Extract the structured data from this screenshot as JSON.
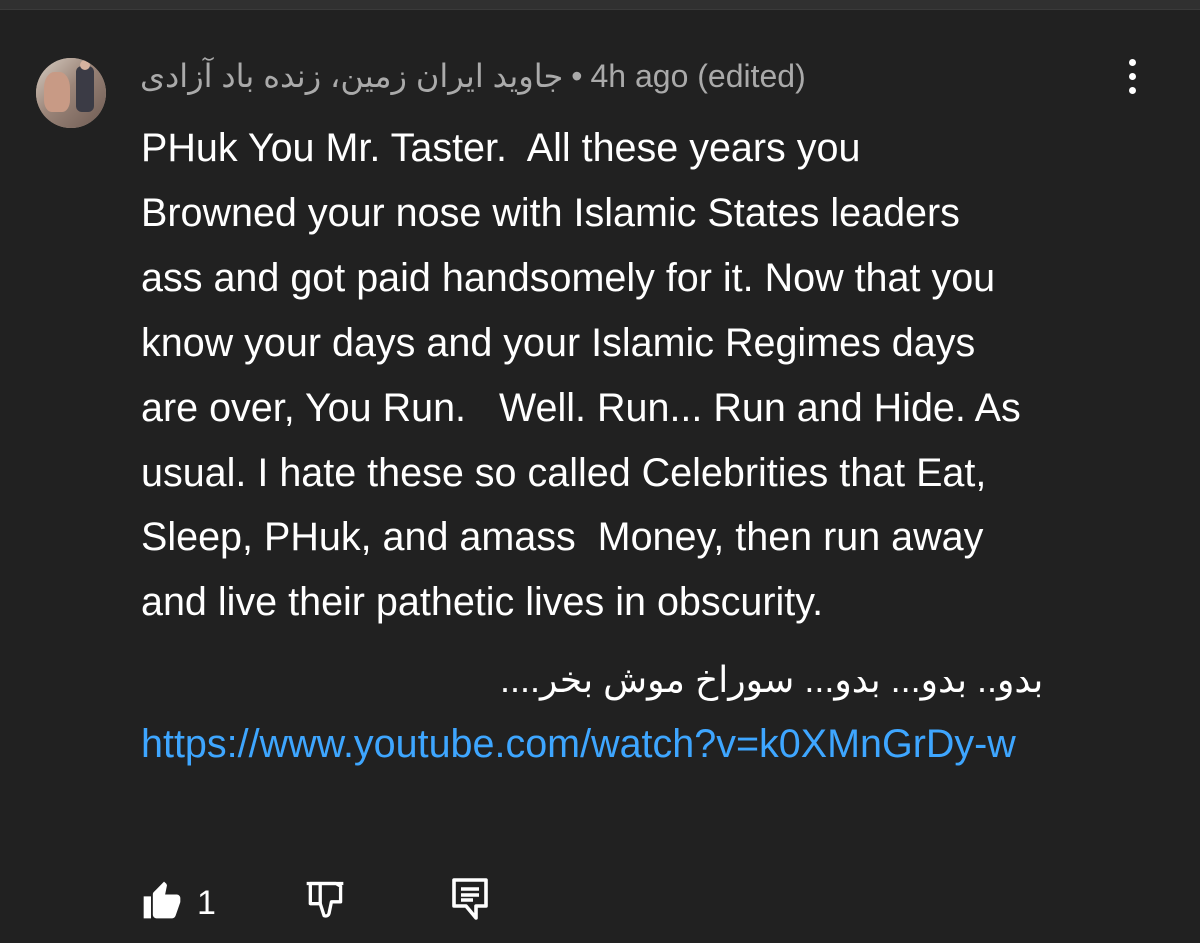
{
  "comment": {
    "author": "جاوید ایران زمین، زنده باد آزادی",
    "separator": "•",
    "meta": "4h ago (edited)",
    "body": "PHuk You Mr. Taster.  All these years you\nBrowned your nose with Islamic States leaders\nass and got paid handsomely for it. Now that you\nknow your days and your Islamic Regimes days\nare over, You Run.   Well. Run... Run and Hide. As\nusual. I hate these so called Celebrities that Eat,\nSleep, PHuk, and amass  Money, then run away\nand live their pathetic lives in obscurity.",
    "persian_line": "بدو.. بدو... بدو... سوراخ موش بخر....",
    "link_text": "https://www.youtube.com/watch?v=k0XMnGrDy-w",
    "link_href": "https://www.youtube.com/watch?v=k0XMnGrDy-w"
  },
  "actions": {
    "like_count": "1",
    "like_icon": "thumbs-up-icon",
    "dislike_icon": "thumbs-down-icon",
    "reply_icon": "reply-icon",
    "menu_icon": "more-vert-icon"
  },
  "colors": {
    "background": "#212121",
    "text_primary": "#ffffff",
    "text_secondary": "#aaaaaa",
    "link": "#3ea6ff"
  }
}
